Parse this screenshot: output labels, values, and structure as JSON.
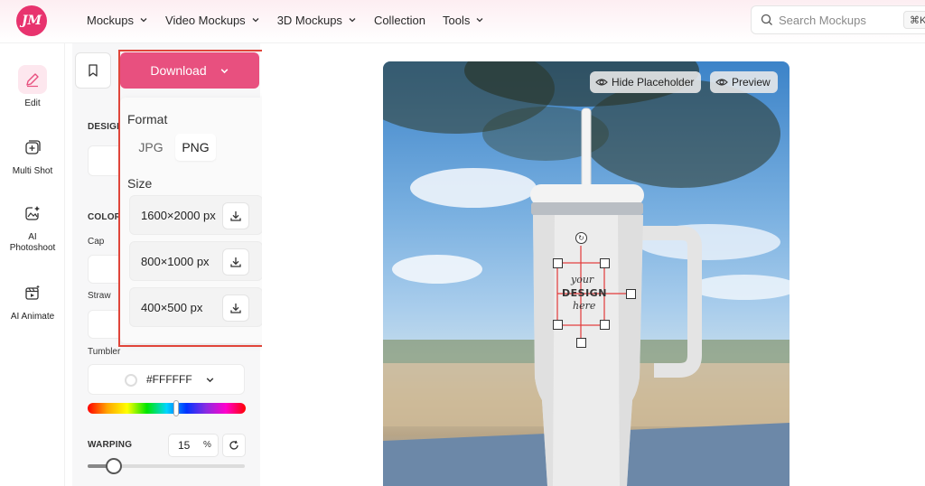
{
  "logo": {
    "text": "JM"
  },
  "nav": {
    "items": [
      {
        "label": "Mockups",
        "has_dropdown": true
      },
      {
        "label": "Video Mockups",
        "has_dropdown": true
      },
      {
        "label": "3D Mockups",
        "has_dropdown": true
      },
      {
        "label": "Collection",
        "has_dropdown": false
      },
      {
        "label": "Tools",
        "has_dropdown": true
      }
    ],
    "search_placeholder": "Search Mockups",
    "search_shortcut": "⌘K"
  },
  "sidebar": {
    "items": [
      {
        "label": "Edit",
        "icon": "pencil-icon",
        "active": true
      },
      {
        "label": "Multi Shot",
        "icon": "multi-shot-icon",
        "active": false
      },
      {
        "label": "AI Photoshoot",
        "icon": "ai-photoshoot-icon",
        "active": false
      },
      {
        "label": "AI Animate",
        "icon": "ai-animate-icon",
        "active": false
      }
    ]
  },
  "panel": {
    "download_label": "Download",
    "design_label": "DESIGN",
    "colors_label": "COLOR",
    "cap_label": "Cap",
    "straw_label": "Straw",
    "tumbler_label": "Tumbler",
    "tumbler_color": "#FFFFFF",
    "hue_position": 0.56,
    "warping_label": "WARPING",
    "warping_value": "15",
    "warping_unit": "%",
    "warping_slider": 0.15
  },
  "download_menu": {
    "format_label": "Format",
    "formats": [
      "JPG",
      "PNG"
    ],
    "selected_format": "PNG",
    "size_label": "Size",
    "sizes": [
      "1600×2000 px",
      "800×1000 px",
      "400×500 px"
    ]
  },
  "preview": {
    "hide_placeholder_label": "Hide Placeholder",
    "preview_label": "Preview",
    "placeholder_lines": [
      "your",
      "DESIGN",
      "here"
    ]
  },
  "colors": {
    "accent": "#e8507f",
    "logo": "#e8336e",
    "highlight": "#e0453a",
    "selection": "#e23a3a"
  }
}
